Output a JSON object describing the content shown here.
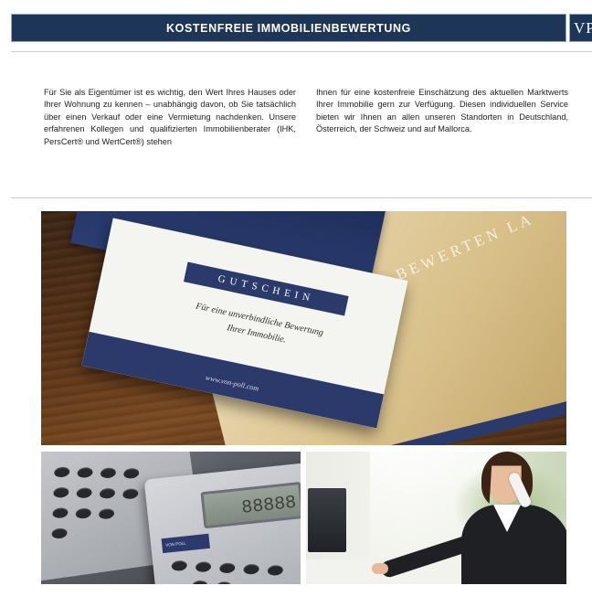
{
  "header": {
    "title": "KOSTENFREIE IMMOBILIENBEWERTUNG",
    "logo_text": "VP"
  },
  "intro": {
    "left_text": "Für Sie als Eigentümer ist es wichtig, den Wert Ihres Hauses oder Ihrer Wohnung zu kennen – unabhängig davon, ob Sie tatsächlich über einen Verkauf oder eine Vermietung nachdenken. Unsere erfahrenen Kollegen und qualifizierten Immobilienberater (IHK, PersCert® und WertCert®) stehen",
    "right_text": "Ihnen für eine kostenfreie Einschätzung des aktuellen Marktwerts Ihrer Immobilie gern zur Verfügung. Diesen individuellen Service bieten wir Ihnen an allen unseren Standorten in Deutschland, Österreich, der Schweiz und auf Mallorca."
  },
  "voucher_photo": {
    "card_title": "GUTSCHEIN",
    "card_line_1": "Für eine unverbindliche Bewertung",
    "card_line_2": "Ihrer Immobilie.",
    "card_url": "www.von-poll.com",
    "folder_text": "DEN BEWERTEN LA"
  },
  "calculator_photo": {
    "display": "88888",
    "sticker_text": "VON POLL"
  },
  "colors": {
    "navy": "#1d3557",
    "card_blue": "#2c3a6b"
  }
}
